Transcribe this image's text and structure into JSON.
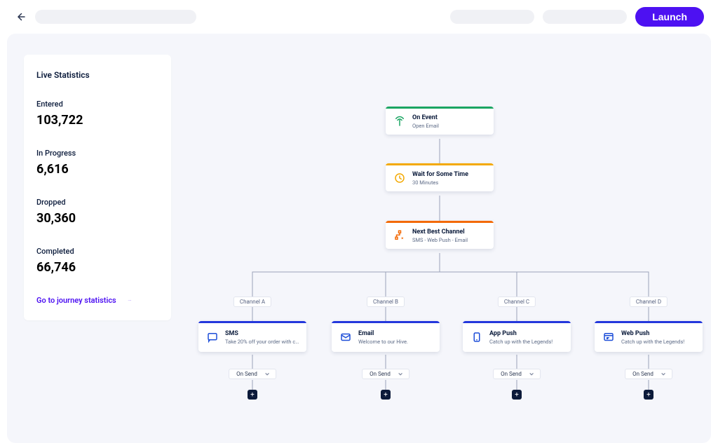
{
  "header": {
    "launch_label": "Launch"
  },
  "sidebar": {
    "title": "Live Statistics",
    "stats": [
      {
        "label": "Entered",
        "value": "103,722"
      },
      {
        "label": "In Progress",
        "value": "6,616"
      },
      {
        "label": "Dropped",
        "value": "30,360"
      },
      {
        "label": "Completed",
        "value": "66,746"
      }
    ],
    "link_label": "Go to journey statistics"
  },
  "nodes": {
    "on_event": {
      "title": "On Event",
      "subtitle": "Open Email",
      "color": "#1aa562"
    },
    "wait": {
      "title": "Wait for Some Time",
      "subtitle": "30 Minutes",
      "color": "#f3a903"
    },
    "best_channel": {
      "title": "Next Best Channel",
      "subtitle": "SMS - Web Push - Email",
      "color": "#f36a06"
    }
  },
  "channels_color": "#2438dc",
  "channels": [
    {
      "tab": "Channel A",
      "title": "SMS",
      "subtitle": "Take 20% off your order with code ...",
      "icon": "sms",
      "on_send": "On Send"
    },
    {
      "tab": "Channel B",
      "title": "Email",
      "subtitle": "Welcome to our Hive.",
      "icon": "email",
      "on_send": "On Send"
    },
    {
      "tab": "Channel C",
      "title": "App Push",
      "subtitle": "Catch up with the Legends!",
      "icon": "app-push",
      "on_send": "On Send"
    },
    {
      "tab": "Channel D",
      "title": "Web Push",
      "subtitle": "Catch up with the Legends!",
      "icon": "web-push",
      "on_send": "On Send"
    }
  ]
}
